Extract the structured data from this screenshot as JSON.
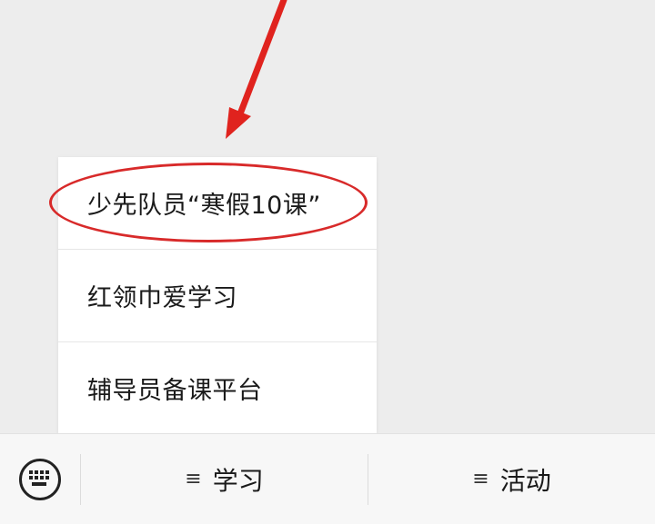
{
  "menu": {
    "items": [
      {
        "label": "少先队员“寒假10课”"
      },
      {
        "label": "红领巾爱学习"
      },
      {
        "label": "辅导员备课平台"
      }
    ]
  },
  "bottom_bar": {
    "keyboard_icon": "keyboard-icon",
    "tabs": [
      {
        "icon": "≡",
        "label": "学习"
      },
      {
        "icon": "≡",
        "label": "活动"
      }
    ]
  },
  "annotation": {
    "color": "#d82a2a"
  }
}
